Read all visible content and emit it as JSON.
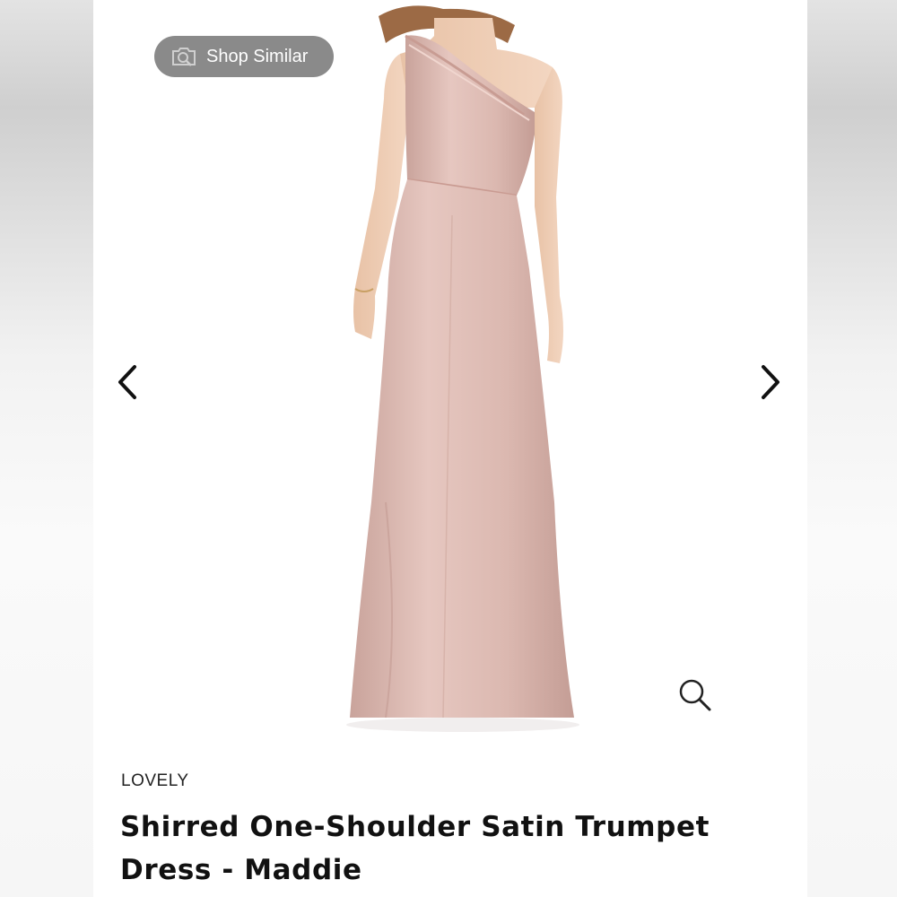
{
  "shop_similar": {
    "label": "Shop Similar",
    "icon": "camera-search-icon"
  },
  "navigation": {
    "prev_icon": "chevron-left-icon",
    "next_icon": "chevron-right-icon"
  },
  "zoom": {
    "icon": "magnifier-icon"
  },
  "product": {
    "brand": "LOVELY",
    "title": "Shirred One-Shoulder Satin Trumpet Dress - Maddie",
    "dress_color": "#dfbdb6"
  }
}
